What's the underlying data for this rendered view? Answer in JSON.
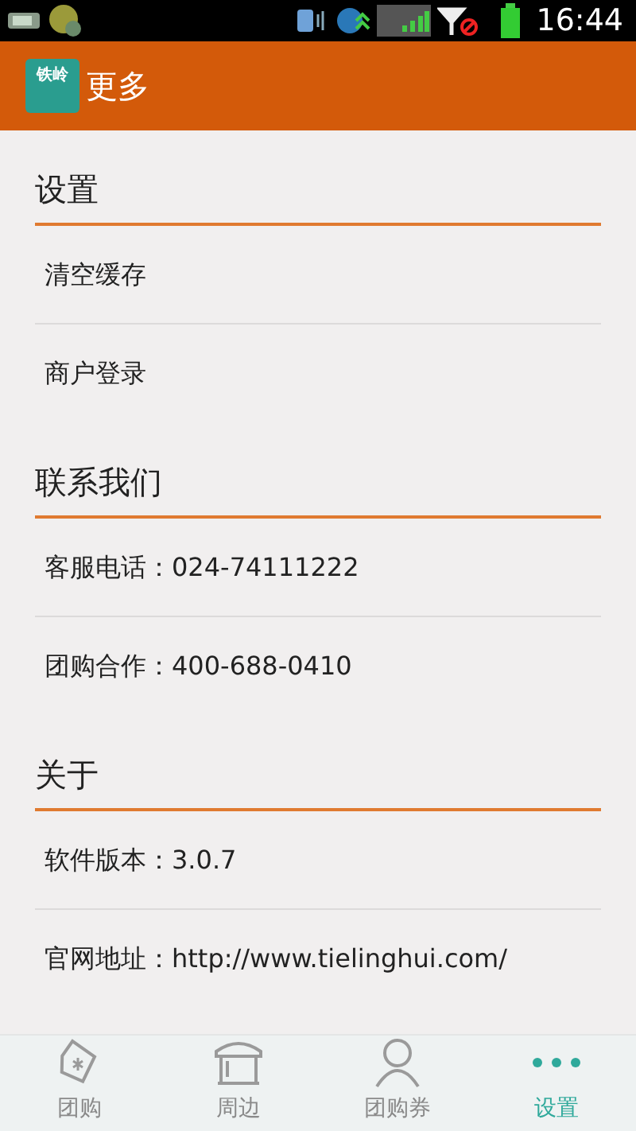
{
  "status_bar": {
    "time": "16:44"
  },
  "app_bar": {
    "logo_text": "铁岭",
    "title": "更多"
  },
  "sections": [
    {
      "title": "设置",
      "items": [
        "清空缓存",
        "商户登录"
      ]
    },
    {
      "title": "联系我们",
      "items": [
        "客服电话：024-74111222",
        "团购合作：400-688-0410"
      ]
    },
    {
      "title": "关于",
      "items": [
        "软件版本：3.0.7",
        "官网地址：http://www.tielinghui.com/"
      ]
    }
  ],
  "bottom_nav": [
    {
      "label": "团购",
      "kind": "tag",
      "selected": false
    },
    {
      "label": "周边",
      "kind": "store",
      "selected": false
    },
    {
      "label": "团购券",
      "kind": "person",
      "selected": false
    },
    {
      "label": "设置",
      "kind": "more",
      "selected": true
    }
  ]
}
